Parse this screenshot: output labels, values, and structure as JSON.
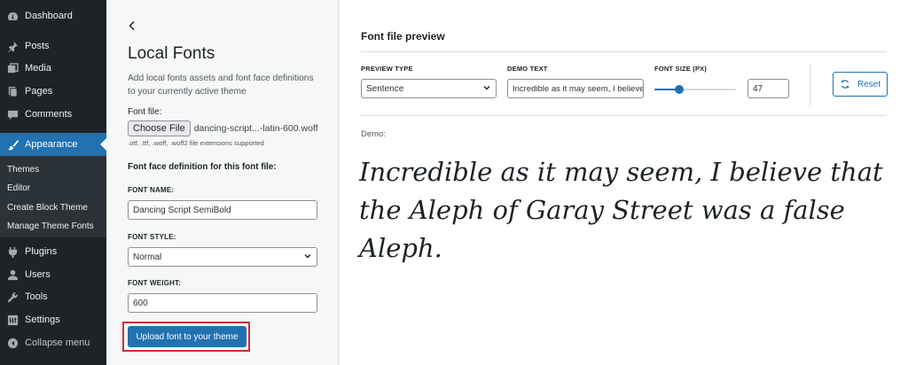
{
  "sidebar": {
    "items": [
      {
        "label": "Dashboard",
        "icon": "dashboard-icon"
      },
      {
        "label": "Posts",
        "icon": "pin-icon"
      },
      {
        "label": "Media",
        "icon": "media-icon"
      },
      {
        "label": "Pages",
        "icon": "pages-icon"
      },
      {
        "label": "Comments",
        "icon": "comment-icon"
      },
      {
        "label": "Appearance",
        "icon": "brush-icon",
        "active": true
      },
      {
        "label": "Plugins",
        "icon": "plug-icon"
      },
      {
        "label": "Users",
        "icon": "user-icon"
      },
      {
        "label": "Tools",
        "icon": "wrench-icon"
      },
      {
        "label": "Settings",
        "icon": "settings-icon"
      }
    ],
    "submenu": [
      "Themes",
      "Editor",
      "Create Block Theme",
      "Manage Theme Fonts"
    ],
    "collapse_label": "Collapse menu"
  },
  "local_fonts": {
    "title": "Local Fonts",
    "description": "Add local fonts assets and font face definitions to your currently active theme",
    "font_file_label": "Font file:",
    "choose_file_label": "Choose File",
    "file_name": "dancing-script...-latin-600.woff",
    "file_hint": ".otf, .ttf, .woff, .woff2 file extensions supported",
    "face_definition_heading": "Font face definition for this font file:",
    "font_name_label": "FONT NAME:",
    "font_name_value": "Dancing Script SemiBold",
    "font_style_label": "FONT STYLE:",
    "font_style_value": "Normal",
    "font_weight_label": "FONT WEIGHT:",
    "font_weight_value": "600",
    "upload_button": "Upload font to your theme"
  },
  "preview": {
    "title": "Font file preview",
    "preview_type_label": "PREVIEW TYPE",
    "preview_type_value": "Sentence",
    "demo_text_label": "DEMO TEXT",
    "demo_text_value": "Incredible as it may seem, I believe that the Aleph of Garay Street was a false Aleph.",
    "font_size_label": "FONT SIZE (PX)",
    "font_size_value": "47",
    "font_size_slider_fraction": 0.3,
    "reset_label": "Reset",
    "demo_label": "Demo:",
    "demo_sentence": "Incredible as it may seem, I believe that the Aleph of Garay Street was a false Aleph."
  },
  "colors": {
    "sidebar_bg": "#1d2327",
    "accent": "#2271b1",
    "highlight": "#d12c39"
  }
}
